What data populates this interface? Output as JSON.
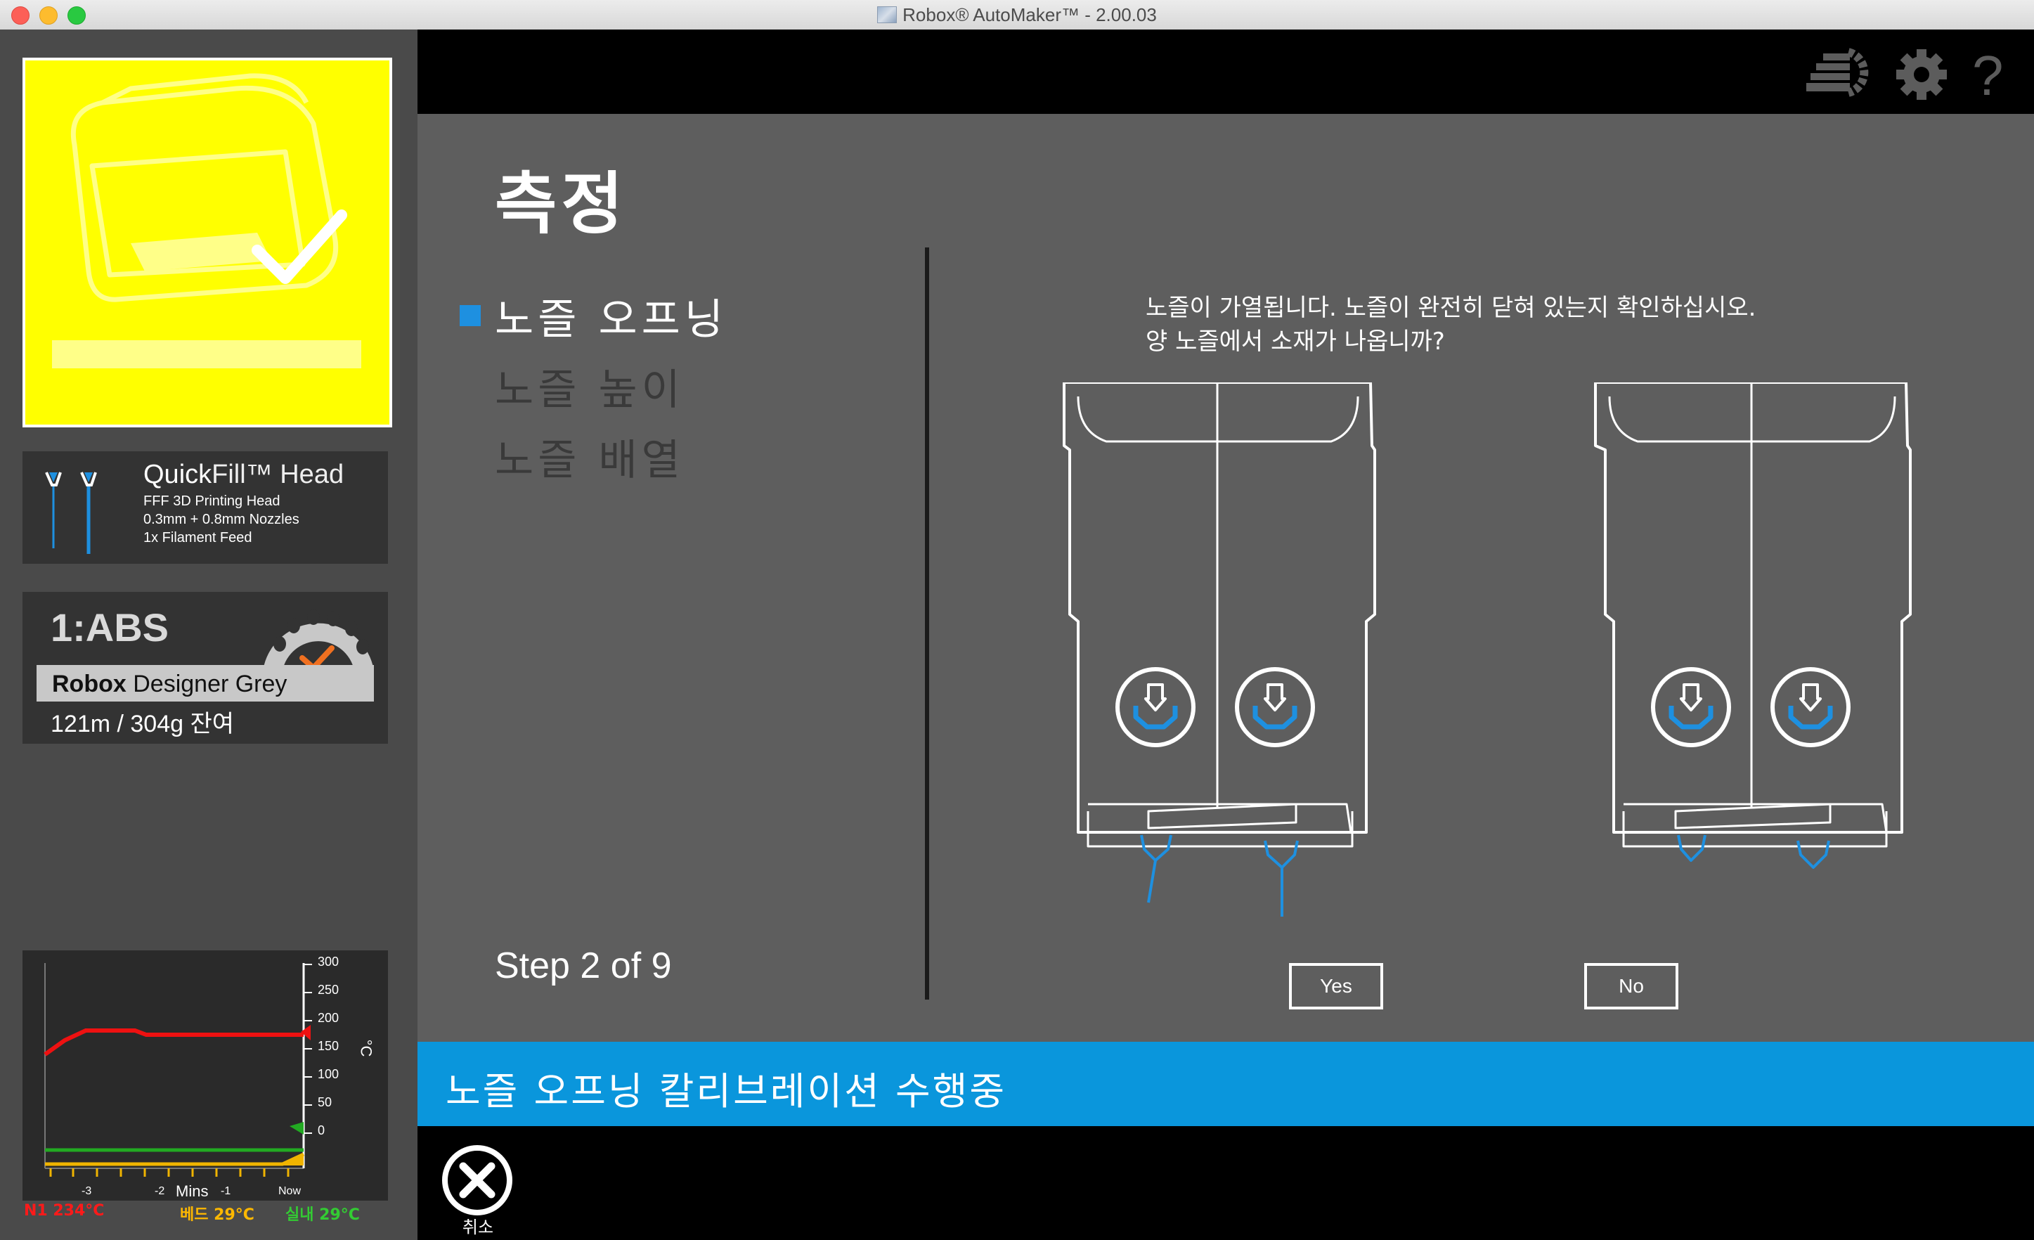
{
  "window": {
    "title": "Robox® AutoMaker™ - 2.00.03"
  },
  "sidebar": {
    "printer_status": "ready",
    "head": {
      "name_bold": "Quick",
      "name_thin": "Fill™ Head",
      "line1": "FFF 3D Printing Head",
      "line2": "0.3mm + 0.8mm Nozzles",
      "line3": "1x Filament Feed"
    },
    "filament": {
      "id": "1:ABS",
      "brand": "Robox",
      "name": " Designer Grey",
      "remaining": "121m / 304g 잔여"
    },
    "temp_graph": {
      "y_ticks": [
        "300",
        "250",
        "200",
        "150",
        "100",
        "50",
        "0"
      ],
      "unit": "°C",
      "x_ticks": [
        "-3",
        "-2",
        "-1",
        "Now"
      ],
      "x_label": "Mins",
      "series_colors": {
        "nozzle": "#ee1111",
        "bed": "#f0b400",
        "ambient": "#22aa22"
      }
    },
    "legend": {
      "nozzle": "N1 234°C",
      "bed": "베드 29°C",
      "ambient": "실내 29°C",
      "nozzle_color": "#ff1a1a",
      "bed_color": "#ffb800",
      "ambient_color": "#33cc33"
    }
  },
  "toolbar": {
    "icons": [
      "layers-icon",
      "gear-icon",
      "help-icon"
    ]
  },
  "main": {
    "title": "측정",
    "steps": [
      {
        "label": "노즐 오프닝",
        "active": true
      },
      {
        "label": "노즐 높이",
        "active": false
      },
      {
        "label": "노즐 배열",
        "active": false
      }
    ],
    "step_counter": "Step 2 of 9",
    "instruction_line1": "노즐이 가열됩니다. 노즐이 완전히 닫혀 있는지 확인하십시오.",
    "instruction_line2": "양 노즐에서 소재가 나옵니까?",
    "yes_label": "Yes",
    "no_label": "No",
    "accent_color": "#1e90e0"
  },
  "banner": {
    "text": "노즐 오프닝 칼리브레이션 수행중",
    "color": "#0a96dc"
  },
  "bottom": {
    "cancel_label": "취소"
  }
}
